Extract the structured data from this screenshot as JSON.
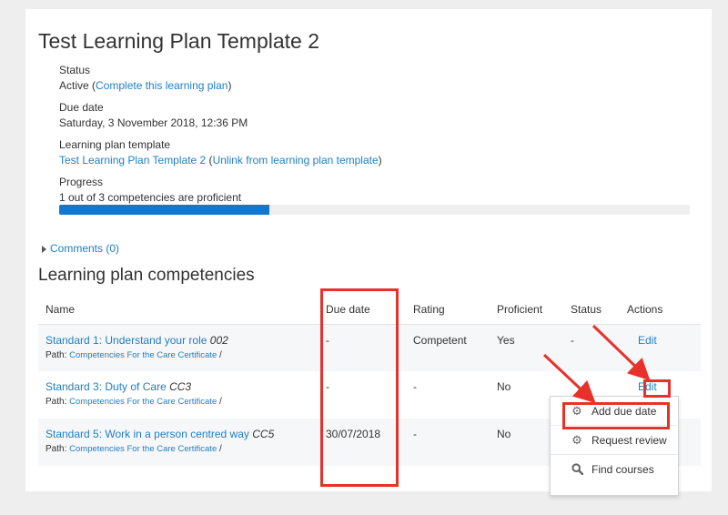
{
  "plan": {
    "title": "Test Learning Plan Template 2",
    "status_label": "Status",
    "status_value": "Active (",
    "status_link": "Complete this learning plan",
    "status_close": ")",
    "due_label": "Due date",
    "due_value": "Saturday, 3 November 2018, 12:36 PM",
    "template_label": "Learning plan template",
    "template_link": "Test Learning Plan Template 2",
    "template_open": " (",
    "template_unlink": "Unlink from learning plan template",
    "template_close": ")",
    "progress_label": "Progress",
    "progress_text": "1 out of 3 competencies are proficient",
    "progress_fraction": 0.333
  },
  "comments": {
    "label": "Comments (0)"
  },
  "competencies": {
    "title": "Learning plan competencies",
    "headers": [
      "Name",
      "Due date",
      "Rating",
      "Proficient",
      "Status",
      "Actions"
    ],
    "path_label": "Path: ",
    "rows": [
      {
        "name": "Standard 1: Understand your role",
        "code": "002",
        "path": "Competencies For the Care Certificate",
        "path_sep": " /",
        "due": "-",
        "rating": "Competent",
        "proficient": "Yes",
        "status": "-",
        "action": "Edit"
      },
      {
        "name": "Standard 3: Duty of Care",
        "code": "CC3",
        "path": "Competencies For the Care Certificate",
        "path_sep": " /",
        "due": "-",
        "rating": "-",
        "proficient": "No",
        "status": "",
        "action": "Edit"
      },
      {
        "name": "Standard 5: Work in a person centred way",
        "code": "CC5",
        "path": "Competencies For the Care Certificate",
        "path_sep": " /",
        "due": "30/07/2018",
        "rating": "-",
        "proficient": "No",
        "status": "",
        "action": ""
      }
    ]
  },
  "menu": {
    "items": [
      {
        "label": "Add due date",
        "icon": "gear-icon"
      },
      {
        "label": "Request review",
        "icon": "gear-icon"
      },
      {
        "label": "Find courses",
        "icon": "search-icon"
      }
    ]
  },
  "colors": {
    "link": "#1f7fc5",
    "progress": "#1177d1",
    "highlight": "#e8312a"
  }
}
